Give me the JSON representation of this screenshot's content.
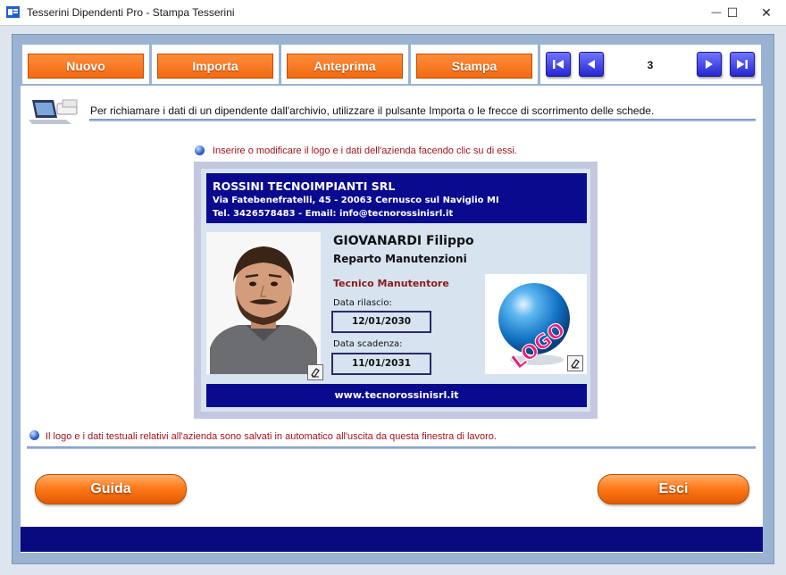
{
  "window": {
    "title": "Tesserini Dipendenti Pro - Stampa Tesserini",
    "minimize": "—",
    "maximize": "☐",
    "close": "✕"
  },
  "toolbar": {
    "new_label": "Nuovo",
    "import_label": "Importa",
    "preview_label": "Anteprima",
    "print_label": "Stampa",
    "record_number": "3"
  },
  "info": {
    "message": "Per richiamare i dati di un dipendente dall'archivio, utilizzare il pulsante Importa o le frecce di scorrimento delle schede.",
    "edit_hint": "Inserire o modificare il logo e i dati dell'azienda facendo clic su di essi.",
    "autosave_note": "Il logo e i dati testuali relativi all'azienda sono salvati in automatico all'uscita da questa finestra di lavoro."
  },
  "card": {
    "company_name": "ROSSINI TECNOIMPIANTI SRL",
    "address": "Via Fatebenefratelli, 45 - 20063 Cernusco sul Naviglio MI",
    "contacts": "Tel. 3426578483 - Email: info@tecnorossinisrl.it",
    "employee_name": "GIOVANARDI Filippo",
    "department": "Reparto Manutenzioni",
    "role": "Tecnico Manutentore",
    "issue_label": "Data rilascio:",
    "issue_date": "12/01/2030",
    "expiry_label": "Data scadenza:",
    "expiry_date": "11/01/2031",
    "logo_text": "LOGO",
    "website": "www.tecnorossinisrl.it"
  },
  "footer": {
    "help_label": "Guida",
    "exit_label": "Esci"
  },
  "colors": {
    "accent_orange": "#f26a12",
    "card_blue": "#0a0a8e",
    "hint_red": "#a2141c",
    "frame_blue": "#9ab3d3"
  }
}
